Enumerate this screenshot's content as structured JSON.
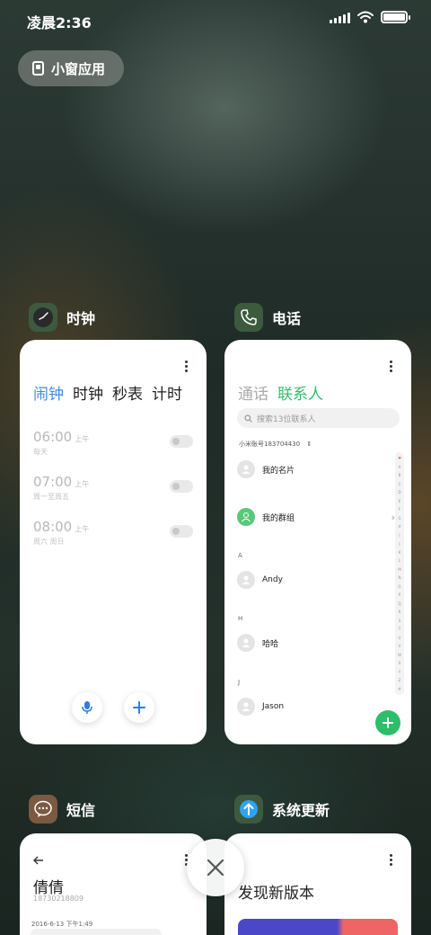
{
  "status_bar": {
    "time": "凌晨2:36",
    "battery_level": 1.0
  },
  "mini_window": {
    "label": "小窗应用"
  },
  "cards": {
    "clock": {
      "app_name": "时钟",
      "tabs": [
        "闹钟",
        "时钟",
        "秒表",
        "计时"
      ],
      "alarms": [
        {
          "time": "06:00",
          "ampm": "上午",
          "repeat": "每天"
        },
        {
          "time": "07:00",
          "ampm": "上午",
          "repeat": "周一至周五"
        },
        {
          "time": "08:00",
          "ampm": "上午",
          "repeat": "周六 周日"
        }
      ]
    },
    "phone": {
      "app_name": "电话",
      "tabs": [
        "通话",
        "联系人"
      ],
      "search_placeholder": "搜索13位联系人",
      "account": "小米账号183704430",
      "my_card": "我的名片",
      "my_group": "我的群组",
      "sections": [
        {
          "letter": "A",
          "contact": "Andy"
        },
        {
          "letter": "H",
          "contact": "哈哈"
        },
        {
          "letter": "J",
          "contact": "Jason"
        }
      ],
      "index_letters": [
        "♥",
        "A",
        "B",
        "C",
        "D",
        "E",
        "F",
        "G",
        "H",
        "I",
        "J",
        "K",
        "L",
        "M",
        "N",
        "O",
        "P",
        "Q",
        "R",
        "S",
        "T",
        "U",
        "V",
        "W",
        "X",
        "Y",
        "Z",
        "#"
      ]
    },
    "messages": {
      "app_name": "短信",
      "contact_name": "倩倩",
      "contact_number": "18730218809",
      "date": "2016-6-13 下午1:49"
    },
    "update": {
      "app_name": "系统更新",
      "title": "发现新版本"
    }
  },
  "colors": {
    "clock_accent": "#3a8ee6",
    "phone_accent": "#2fbf6c",
    "update_accent": "#4a47c9"
  }
}
